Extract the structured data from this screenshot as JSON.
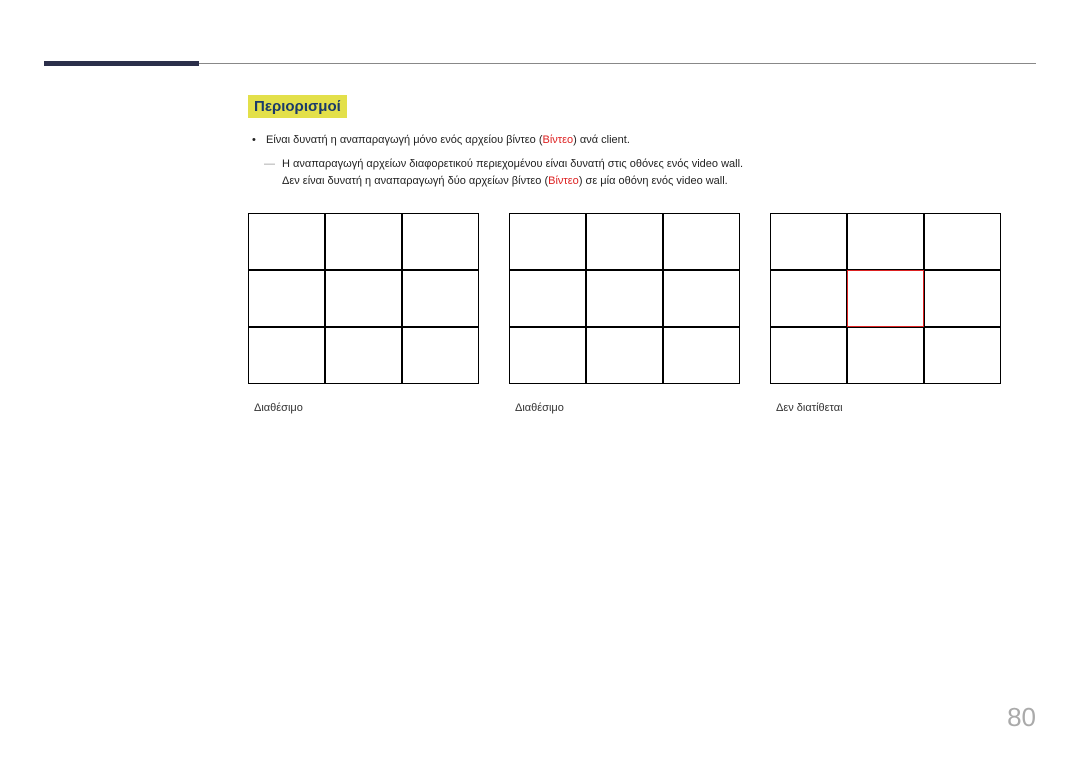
{
  "section_title": "Περιορισμοί",
  "bullet": {
    "prefix": "Είναι δυνατή η αναπαραγωγή μόνο ενός αρχείου βίντεο (",
    "highlight": "Βίντεο",
    "suffix": ") ανά client."
  },
  "dash": {
    "line1": "Η αναπαραγωγή αρχείων διαφορετικού περιεχομένου είναι δυνατή στις οθόνες ενός video wall.",
    "line2_prefix": "Δεν είναι δυνατή η αναπαραγωγή δύο αρχείων βίντεο (",
    "line2_highlight": "Βίντεο",
    "line2_suffix": ") σε μία οθόνη ενός video wall."
  },
  "grids": [
    {
      "caption": "Διαθέσιμο",
      "special": "none"
    },
    {
      "caption": "Διαθέσιμο",
      "special": "none"
    },
    {
      "caption": "Δεν διατίθεται",
      "special": "red-center"
    }
  ],
  "page_number": "80"
}
